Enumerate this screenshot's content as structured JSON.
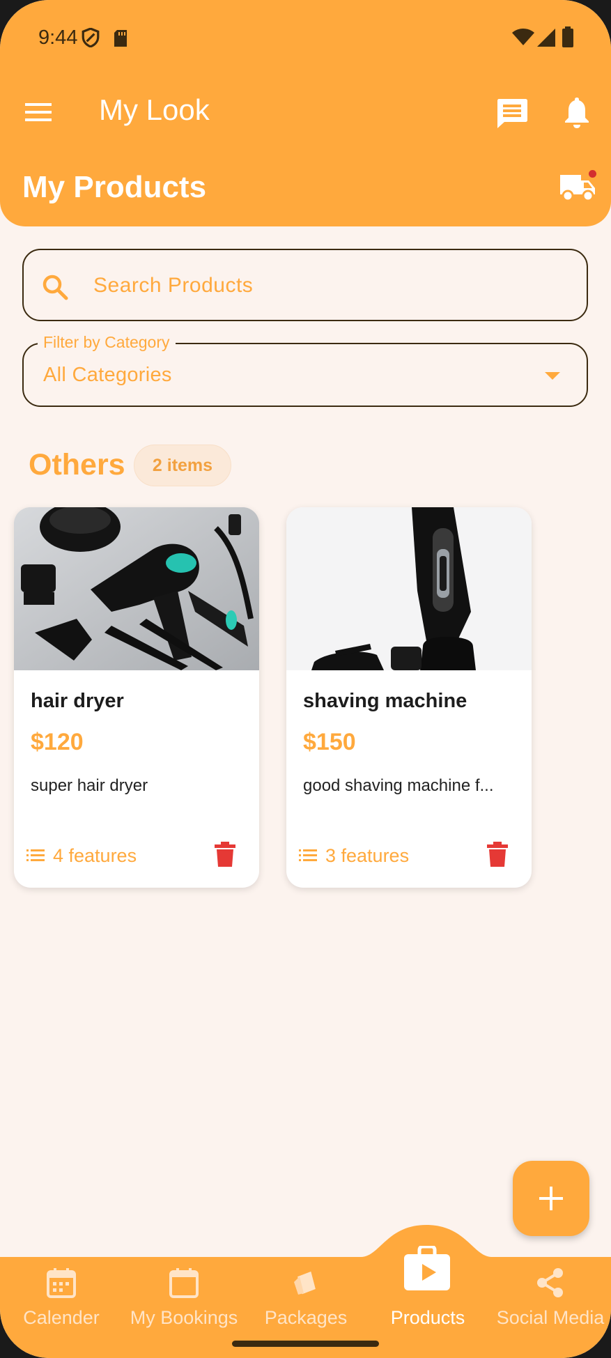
{
  "status_bar": {
    "time": "9:44"
  },
  "app_bar": {
    "title": "My Look"
  },
  "page": {
    "title": "My Products"
  },
  "search": {
    "placeholder": "Search Products",
    "value": ""
  },
  "filter": {
    "label": "Filter by Category",
    "selected": "All Categories"
  },
  "section": {
    "title": "Others",
    "count": "2 items"
  },
  "products": [
    {
      "name": "hair dryer",
      "price": "$120",
      "description": "super hair dryer",
      "features": "4 features",
      "image_icon": "hair-dryer-photo"
    },
    {
      "name": "shaving machine",
      "price": "$150",
      "description": "good shaving machine f...",
      "features": "3 features",
      "image_icon": "shaving-machine-photo"
    }
  ],
  "bottom_nav": {
    "items": [
      {
        "label": "Calender",
        "icon": "calendar-icon"
      },
      {
        "label": "My Bookings",
        "icon": "calendar-blank-icon"
      },
      {
        "label": "Packages",
        "icon": "packages-icon"
      },
      {
        "label": "Products",
        "icon": "shopping-bag-play-icon",
        "active": true
      },
      {
        "label": "Social Media",
        "icon": "share-icon"
      }
    ]
  },
  "colors": {
    "primary": "#ffa93d",
    "background": "#fcf3ee",
    "delete": "#e53935",
    "badge_bg": "#fbe9d9"
  }
}
